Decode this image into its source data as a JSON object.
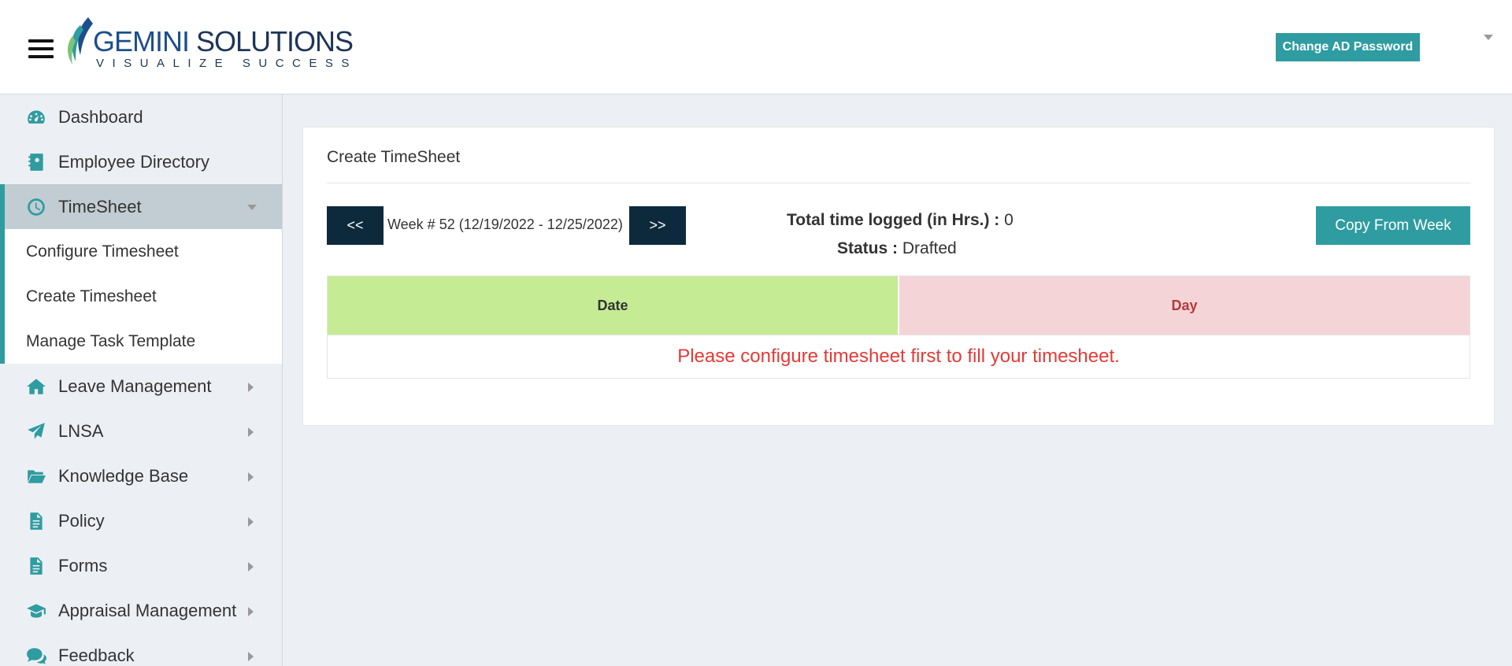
{
  "header": {
    "logo": {
      "brand_primary": "GEMINI",
      "brand_secondary": "SOLUTIONS",
      "tagline": "VISUALIZE SUCCESS"
    },
    "change_password_label": "Change AD Password"
  },
  "sidebar": {
    "items": [
      {
        "label": "Dashboard",
        "icon": "dashboard-icon"
      },
      {
        "label": "Employee Directory",
        "icon": "address-book-icon"
      },
      {
        "label": "TimeSheet",
        "icon": "clock-icon",
        "active": true,
        "children": [
          "Configure Timesheet",
          "Create Timesheet",
          "Manage Task Template"
        ]
      },
      {
        "label": "Leave Management",
        "icon": "home-icon"
      },
      {
        "label": "LNSA",
        "icon": "paper-plane-icon"
      },
      {
        "label": "Knowledge Base",
        "icon": "folder-open-icon"
      },
      {
        "label": "Policy",
        "icon": "document-icon"
      },
      {
        "label": "Forms",
        "icon": "document-icon"
      },
      {
        "label": "Appraisal Management",
        "icon": "graduation-cap-icon"
      },
      {
        "label": "Feedback",
        "icon": "comments-icon"
      }
    ]
  },
  "main": {
    "title": "Create TimeSheet",
    "prev_label": "<<",
    "next_label": ">>",
    "week_label": "Week # 52 (12/19/2022 - 12/25/2022)",
    "total_label": "Total time logged (in Hrs.) :",
    "total_value": "0",
    "status_label": "Status :",
    "status_value": "Drafted",
    "copy_label": "Copy From Week",
    "table": {
      "columns": [
        "Date",
        "Day"
      ],
      "message": "Please configure timesheet first to fill your timesheet."
    }
  },
  "colors": {
    "accent": "#2e9ca0",
    "nav_dark": "#0d2a3d",
    "date_header_bg": "#c5ec95",
    "day_header_bg": "#f5d4d8",
    "error_text": "#e53935"
  }
}
